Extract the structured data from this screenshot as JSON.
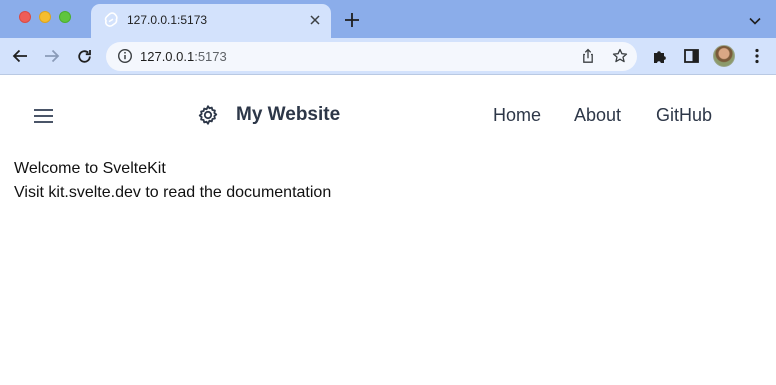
{
  "browser": {
    "tab": {
      "title": "127.0.0.1:5173",
      "favicon": "svelte-logo-icon"
    },
    "address": {
      "host": "127.0.0.1",
      "port": ":5173"
    },
    "colors": {
      "tabstrip": "#8badea",
      "toolbar": "#d3e2fc"
    }
  },
  "page": {
    "header": {
      "site_title": "My Website",
      "nav": [
        {
          "label": "Home"
        },
        {
          "label": "About"
        },
        {
          "label": "GitHub"
        }
      ]
    },
    "main": {
      "line1": "Welcome to SvelteKit",
      "line2": "Visit kit.svelte.dev to read the documentation"
    }
  }
}
